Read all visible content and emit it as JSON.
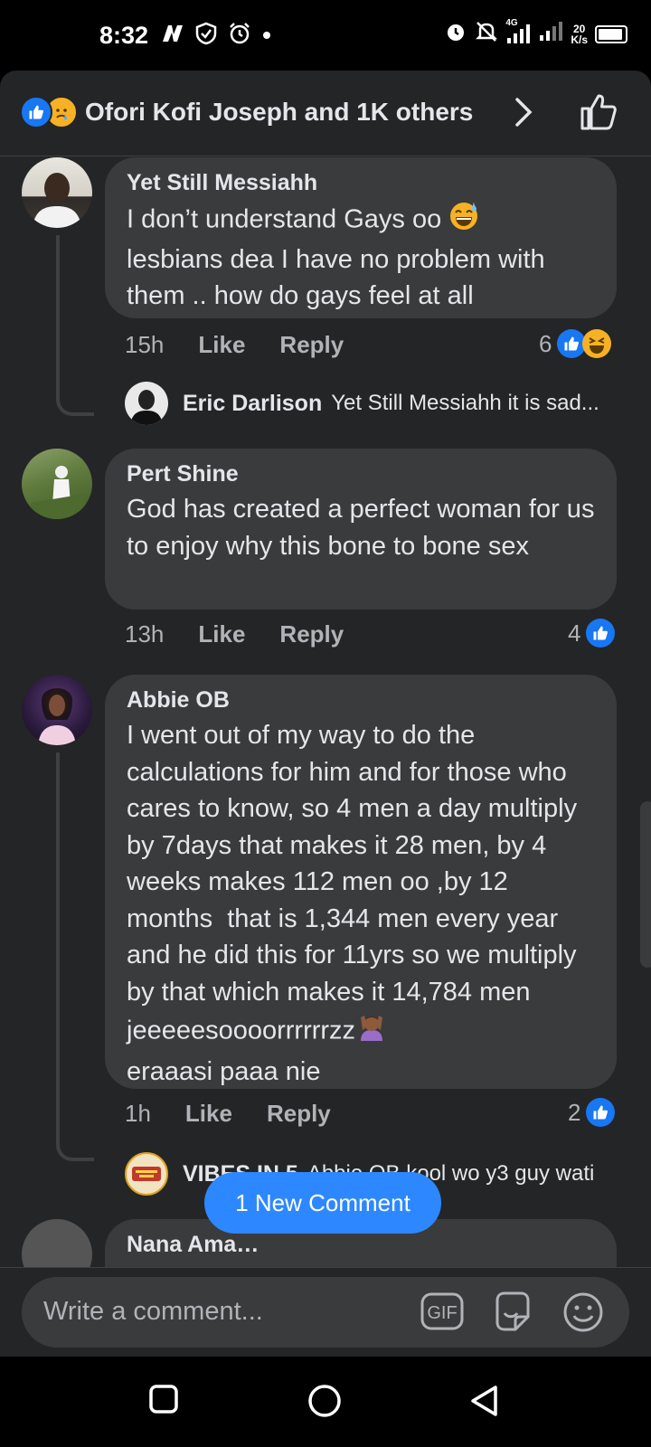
{
  "status_bar": {
    "time": "8:32",
    "network": "4G",
    "speed_value": "20",
    "speed_unit": "K/s"
  },
  "header": {
    "title": "Ofori Kofi Joseph and 1K others",
    "reaction_icons": [
      "like-icon",
      "sad-icon"
    ]
  },
  "comments": [
    {
      "author": "Yet Still Messiahh",
      "text": "I don’t understand Gays oo",
      "text_cont": "lesbians dea I have no problem with them .. how do gays feel at all",
      "inline_emoji": "sweat-smile-icon",
      "time": "15h",
      "like_label": "Like",
      "reply_label": "Reply",
      "reaction_count": "6",
      "reaction_icons": [
        "like-icon",
        "haha-icon"
      ],
      "reply_preview": {
        "name": "Eric Darlison",
        "snippet": "Yet Still Messiahh it is sad..."
      }
    },
    {
      "author": "Pert Shine",
      "text": "God has created a perfect woman for us to enjoy why this bone to bone sex",
      "time": "13h",
      "like_label": "Like",
      "reply_label": "Reply",
      "reaction_count": "4",
      "reaction_icons": [
        "like-icon"
      ]
    },
    {
      "author": "Abbie OB",
      "text": "I went out of my way to do the calculations for him and for those who cares to know, so 4 men a day multiply by 7days that makes it 28 men, by 4 weeks makes 112 men oo ,by 12 months  that is 1,344 men every year and he did this for 11yrs so we multiply by that which makes it 14,784 men jeeeeesoooorrrrrrzz",
      "text_end": "eraaasi paaa nie",
      "inline_emoji": "facepalm-woman-icon",
      "time": "1h",
      "like_label": "Like",
      "reply_label": "Reply",
      "reaction_count": "2",
      "reaction_icons": [
        "like-icon"
      ],
      "reply_preview": {
        "name": "VIBES IN 5",
        "snippet": "Abbie OB kool wo y3 guy wati"
      }
    }
  ],
  "partial_next_author": "Nana Ama…",
  "new_comment_pill": "1 New Comment",
  "composer": {
    "placeholder": "Write a comment...",
    "gif_label": "GIF"
  },
  "colors": {
    "background": "#242526",
    "bubble": "#3a3b3c",
    "accent": "#1877f2",
    "pill": "#2d88ff"
  }
}
